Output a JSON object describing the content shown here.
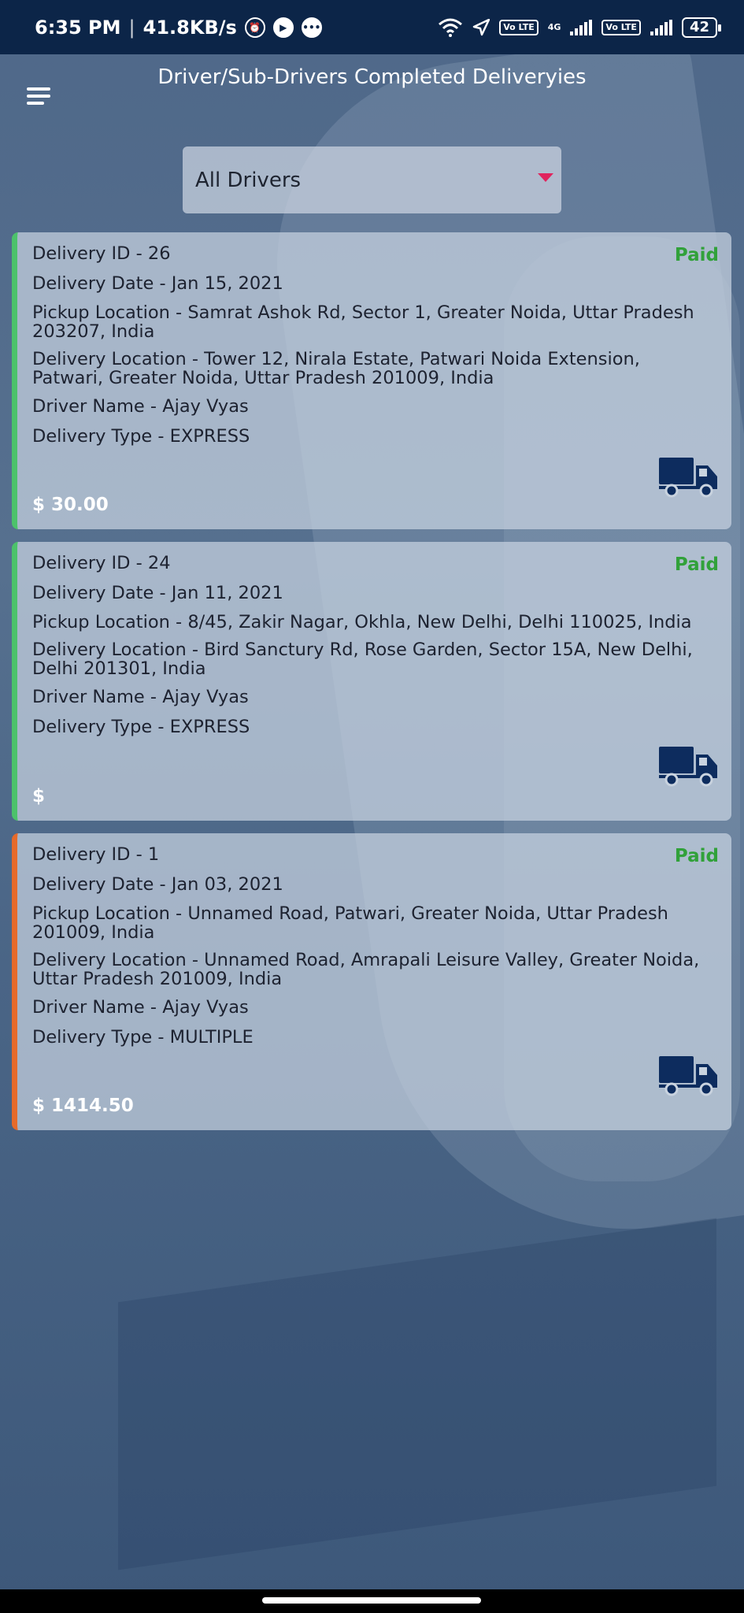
{
  "status_bar": {
    "time": "6:35 PM",
    "speed": "41.8KB/s",
    "battery": "42",
    "icons": [
      "alarm-icon",
      "play-icon",
      "message-icon",
      "wifi-icon",
      "location-icon",
      "volte-icon",
      "signal-icon",
      "volte-icon",
      "signal-icon",
      "battery-icon"
    ],
    "volte_label": "Vo LTE",
    "network_label": "4G"
  },
  "header": {
    "title": "Driver/Sub-Drivers Completed Deliveryies",
    "menu_icon": "hamburger-menu-icon"
  },
  "filter": {
    "selected": "All Drivers",
    "caret_color": "#e0245e"
  },
  "deliveries": [
    {
      "id": "Delivery ID - 26",
      "date": "Delivery Date - Jan 15, 2021",
      "pickup": "Pickup Location - Samrat Ashok Rd, Sector 1, Greater Noida, Uttar Pradesh 203207, India",
      "delivery": "Delivery Location - Tower 12, Nirala Estate, Patwari Noida Extension, Patwari, Greater Noida, Uttar Pradesh 201009, India",
      "driver": "Driver Name  - Ajay Vyas",
      "type": "Delivery Type - EXPRESS",
      "status": "Paid",
      "price": "$ 30.00",
      "accent": "#4cc26b",
      "icon": "truck-icon"
    },
    {
      "id": "Delivery ID - 24",
      "date": "Delivery Date - Jan 11, 2021",
      "pickup": "Pickup Location - 8/45, Zakir Nagar, Okhla, New Delhi, Delhi 110025, India",
      "delivery": "Delivery Location - Bird Sanctury Rd, Rose Garden, Sector 15A, New Delhi, Delhi 201301, India",
      "driver": "Driver Name  - Ajay Vyas",
      "type": "Delivery Type - EXPRESS",
      "status": "Paid",
      "price": "$",
      "accent": "#4cc26b",
      "icon": "truck-icon"
    },
    {
      "id": "Delivery ID - 1",
      "date": "Delivery Date - Jan 03, 2021",
      "pickup": "Pickup Location - Unnamed Road, Patwari, Greater Noida, Uttar Pradesh 201009, India",
      "delivery": "Delivery Location - Unnamed Road, Amrapali Leisure Valley, Greater Noida, Uttar Pradesh 201009, India",
      "driver": "Driver Name  - Ajay Vyas",
      "type": "Delivery Type - MULTIPLE",
      "status": "Paid",
      "price": "$ 1414.50",
      "accent": "#e66a2a",
      "icon": "truck-icon"
    }
  ],
  "colors": {
    "status_bar": "#0c2548",
    "paid": "#31a13a",
    "truck": "#0d2c5e"
  }
}
